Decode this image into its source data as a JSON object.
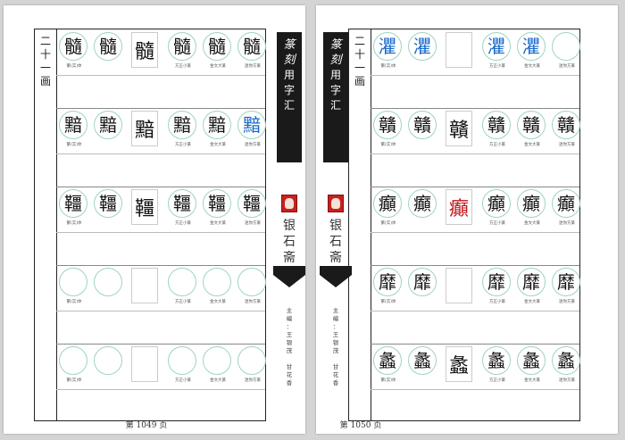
{
  "book": {
    "title_chars": [
      "篆",
      "刻",
      "用",
      "字",
      "汇"
    ],
    "publisher_chars": [
      "银",
      "石",
      "斋"
    ],
    "editors_text": [
      "主",
      "编",
      "：",
      "王",
      "银",
      "茂",
      " ",
      "甘",
      "花",
      "香"
    ]
  },
  "captions": {
    "traditional": "繁(实)体",
    "small_seal": "方正小篆",
    "bronze": "金文大篆",
    "mini": "迷你方篆"
  },
  "colors": {
    "blue_glyph": "#1566c8",
    "red_glyph": "#c0161b",
    "circle_border": "#9fd3c2"
  },
  "left_page": {
    "label_chars": [
      "二",
      "十",
      "一",
      "画"
    ],
    "page_number": "第 1049 页",
    "rows": [
      [
        "髓",
        "髓",
        "髓",
        "髓",
        "髓",
        "髓"
      ],
      [
        "黯",
        "黯",
        "黯",
        "黯",
        "黯",
        "黯"
      ],
      [
        "韁",
        "韁",
        "韁",
        "韁",
        "韁",
        "韁"
      ],
      [
        "",
        "",
        "",
        "",
        "",
        ""
      ],
      [
        "",
        "",
        "",
        "",
        "",
        ""
      ]
    ]
  },
  "right_page": {
    "label_chars": [
      "二",
      "十",
      "一",
      "画"
    ],
    "page_number": "第 1050 页",
    "rows": [
      [
        "灈",
        "灈",
        "",
        "灈",
        "灈",
        ""
      ],
      [
        "贛",
        "贛",
        "贛",
        "贛",
        "贛",
        "贛"
      ],
      [
        "癲",
        "癲",
        "癲",
        "癲",
        "癲",
        "癲"
      ],
      [
        "靡",
        "靡",
        "",
        "靡",
        "靡",
        "靡"
      ],
      [
        "蠡",
        "蠡",
        "蠡",
        "蠡",
        "蠡",
        "蠡"
      ]
    ]
  }
}
